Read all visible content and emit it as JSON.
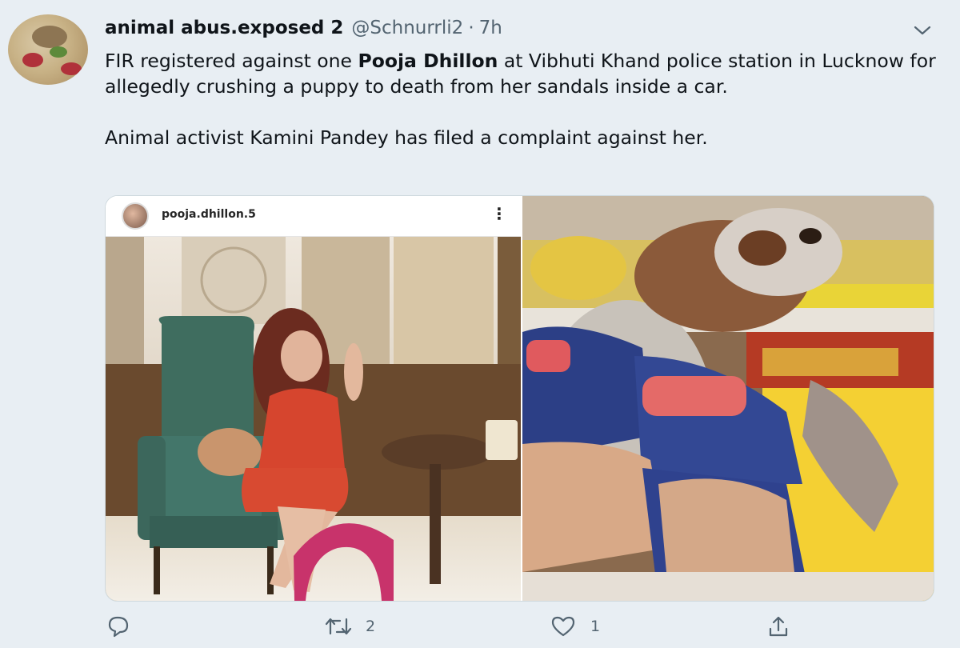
{
  "tweet": {
    "display_name": "animal abus.exposed 2",
    "handle": "@Schnurrli2",
    "separator": "·",
    "time": "7h",
    "text_p1_a": "FIR registered against one ",
    "text_p1_bold": "Pooja Dhillon",
    "text_p1_b": " at Vibhuti Khand police station in Lucknow for allegedly crushing a puppy to death from her sandals inside a car.",
    "text_p2": "Animal activist Kamini Pandey has filed a complaint against her."
  },
  "media": {
    "left_username": "pooja.dhillon.5",
    "left_more": "⋮"
  },
  "actions": {
    "reply_count": "",
    "retweet_count": "2",
    "like_count": "1"
  },
  "colors": {
    "background": "#e8eef3",
    "muted_text": "#536471",
    "text": "#0f1419"
  },
  "icons": [
    "chevron-down-icon",
    "reply-icon",
    "retweet-icon",
    "like-icon",
    "share-icon",
    "more-icon"
  ]
}
